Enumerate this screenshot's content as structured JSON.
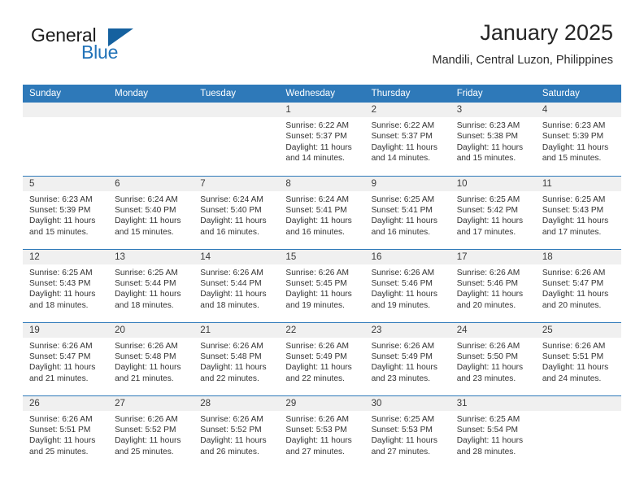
{
  "logo": {
    "word_general": "General",
    "word_blue": "Blue",
    "triangle_color": "#15619f",
    "blue_text_color": "#2273b8"
  },
  "header": {
    "title": "January 2025",
    "subtitle": "Mandili, Central Luzon, Philippines"
  },
  "theme": {
    "header_bg": "#2e79b9",
    "daynum_bg": "#f0f0f0",
    "row_border": "#2e79b9",
    "page_bg": "#ffffff"
  },
  "weekday_headers": [
    "Sunday",
    "Monday",
    "Tuesday",
    "Wednesday",
    "Thursday",
    "Friday",
    "Saturday"
  ],
  "labels": {
    "sunrise_prefix": "Sunrise:",
    "sunset_prefix": "Sunset:",
    "daylight_prefix": "Daylight:"
  },
  "weeks": [
    [
      {
        "day": "",
        "empty": true
      },
      {
        "day": "",
        "empty": true
      },
      {
        "day": "",
        "empty": true
      },
      {
        "day": "1",
        "sunrise": "Sunrise: 6:22 AM",
        "sunset": "Sunset: 5:37 PM",
        "daylight1": "Daylight: 11 hours",
        "daylight2": "and 14 minutes."
      },
      {
        "day": "2",
        "sunrise": "Sunrise: 6:22 AM",
        "sunset": "Sunset: 5:37 PM",
        "daylight1": "Daylight: 11 hours",
        "daylight2": "and 14 minutes."
      },
      {
        "day": "3",
        "sunrise": "Sunrise: 6:23 AM",
        "sunset": "Sunset: 5:38 PM",
        "daylight1": "Daylight: 11 hours",
        "daylight2": "and 15 minutes."
      },
      {
        "day": "4",
        "sunrise": "Sunrise: 6:23 AM",
        "sunset": "Sunset: 5:39 PM",
        "daylight1": "Daylight: 11 hours",
        "daylight2": "and 15 minutes."
      }
    ],
    [
      {
        "day": "5",
        "sunrise": "Sunrise: 6:23 AM",
        "sunset": "Sunset: 5:39 PM",
        "daylight1": "Daylight: 11 hours",
        "daylight2": "and 15 minutes."
      },
      {
        "day": "6",
        "sunrise": "Sunrise: 6:24 AM",
        "sunset": "Sunset: 5:40 PM",
        "daylight1": "Daylight: 11 hours",
        "daylight2": "and 15 minutes."
      },
      {
        "day": "7",
        "sunrise": "Sunrise: 6:24 AM",
        "sunset": "Sunset: 5:40 PM",
        "daylight1": "Daylight: 11 hours",
        "daylight2": "and 16 minutes."
      },
      {
        "day": "8",
        "sunrise": "Sunrise: 6:24 AM",
        "sunset": "Sunset: 5:41 PM",
        "daylight1": "Daylight: 11 hours",
        "daylight2": "and 16 minutes."
      },
      {
        "day": "9",
        "sunrise": "Sunrise: 6:25 AM",
        "sunset": "Sunset: 5:41 PM",
        "daylight1": "Daylight: 11 hours",
        "daylight2": "and 16 minutes."
      },
      {
        "day": "10",
        "sunrise": "Sunrise: 6:25 AM",
        "sunset": "Sunset: 5:42 PM",
        "daylight1": "Daylight: 11 hours",
        "daylight2": "and 17 minutes."
      },
      {
        "day": "11",
        "sunrise": "Sunrise: 6:25 AM",
        "sunset": "Sunset: 5:43 PM",
        "daylight1": "Daylight: 11 hours",
        "daylight2": "and 17 minutes."
      }
    ],
    [
      {
        "day": "12",
        "sunrise": "Sunrise: 6:25 AM",
        "sunset": "Sunset: 5:43 PM",
        "daylight1": "Daylight: 11 hours",
        "daylight2": "and 18 minutes."
      },
      {
        "day": "13",
        "sunrise": "Sunrise: 6:25 AM",
        "sunset": "Sunset: 5:44 PM",
        "daylight1": "Daylight: 11 hours",
        "daylight2": "and 18 minutes."
      },
      {
        "day": "14",
        "sunrise": "Sunrise: 6:26 AM",
        "sunset": "Sunset: 5:44 PM",
        "daylight1": "Daylight: 11 hours",
        "daylight2": "and 18 minutes."
      },
      {
        "day": "15",
        "sunrise": "Sunrise: 6:26 AM",
        "sunset": "Sunset: 5:45 PM",
        "daylight1": "Daylight: 11 hours",
        "daylight2": "and 19 minutes."
      },
      {
        "day": "16",
        "sunrise": "Sunrise: 6:26 AM",
        "sunset": "Sunset: 5:46 PM",
        "daylight1": "Daylight: 11 hours",
        "daylight2": "and 19 minutes."
      },
      {
        "day": "17",
        "sunrise": "Sunrise: 6:26 AM",
        "sunset": "Sunset: 5:46 PM",
        "daylight1": "Daylight: 11 hours",
        "daylight2": "and 20 minutes."
      },
      {
        "day": "18",
        "sunrise": "Sunrise: 6:26 AM",
        "sunset": "Sunset: 5:47 PM",
        "daylight1": "Daylight: 11 hours",
        "daylight2": "and 20 minutes."
      }
    ],
    [
      {
        "day": "19",
        "sunrise": "Sunrise: 6:26 AM",
        "sunset": "Sunset: 5:47 PM",
        "daylight1": "Daylight: 11 hours",
        "daylight2": "and 21 minutes."
      },
      {
        "day": "20",
        "sunrise": "Sunrise: 6:26 AM",
        "sunset": "Sunset: 5:48 PM",
        "daylight1": "Daylight: 11 hours",
        "daylight2": "and 21 minutes."
      },
      {
        "day": "21",
        "sunrise": "Sunrise: 6:26 AM",
        "sunset": "Sunset: 5:48 PM",
        "daylight1": "Daylight: 11 hours",
        "daylight2": "and 22 minutes."
      },
      {
        "day": "22",
        "sunrise": "Sunrise: 6:26 AM",
        "sunset": "Sunset: 5:49 PM",
        "daylight1": "Daylight: 11 hours",
        "daylight2": "and 22 minutes."
      },
      {
        "day": "23",
        "sunrise": "Sunrise: 6:26 AM",
        "sunset": "Sunset: 5:49 PM",
        "daylight1": "Daylight: 11 hours",
        "daylight2": "and 23 minutes."
      },
      {
        "day": "24",
        "sunrise": "Sunrise: 6:26 AM",
        "sunset": "Sunset: 5:50 PM",
        "daylight1": "Daylight: 11 hours",
        "daylight2": "and 23 minutes."
      },
      {
        "day": "25",
        "sunrise": "Sunrise: 6:26 AM",
        "sunset": "Sunset: 5:51 PM",
        "daylight1": "Daylight: 11 hours",
        "daylight2": "and 24 minutes."
      }
    ],
    [
      {
        "day": "26",
        "sunrise": "Sunrise: 6:26 AM",
        "sunset": "Sunset: 5:51 PM",
        "daylight1": "Daylight: 11 hours",
        "daylight2": "and 25 minutes."
      },
      {
        "day": "27",
        "sunrise": "Sunrise: 6:26 AM",
        "sunset": "Sunset: 5:52 PM",
        "daylight1": "Daylight: 11 hours",
        "daylight2": "and 25 minutes."
      },
      {
        "day": "28",
        "sunrise": "Sunrise: 6:26 AM",
        "sunset": "Sunset: 5:52 PM",
        "daylight1": "Daylight: 11 hours",
        "daylight2": "and 26 minutes."
      },
      {
        "day": "29",
        "sunrise": "Sunrise: 6:26 AM",
        "sunset": "Sunset: 5:53 PM",
        "daylight1": "Daylight: 11 hours",
        "daylight2": "and 27 minutes."
      },
      {
        "day": "30",
        "sunrise": "Sunrise: 6:25 AM",
        "sunset": "Sunset: 5:53 PM",
        "daylight1": "Daylight: 11 hours",
        "daylight2": "and 27 minutes."
      },
      {
        "day": "31",
        "sunrise": "Sunrise: 6:25 AM",
        "sunset": "Sunset: 5:54 PM",
        "daylight1": "Daylight: 11 hours",
        "daylight2": "and 28 minutes."
      },
      {
        "day": "",
        "empty": true
      }
    ]
  ]
}
